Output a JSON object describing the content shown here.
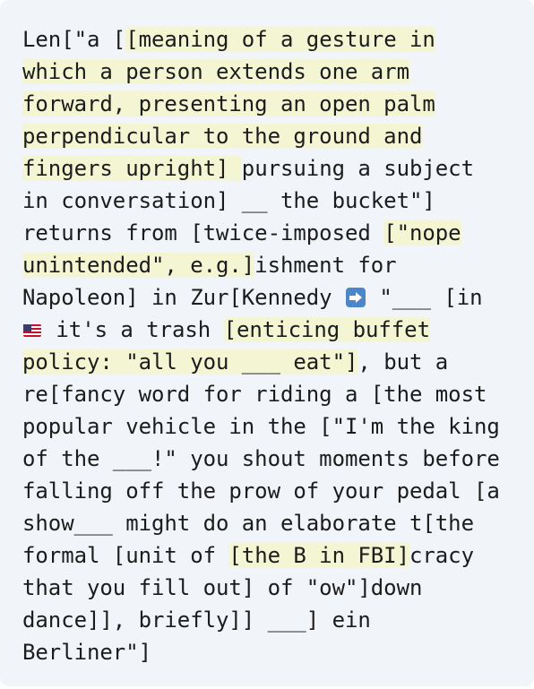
{
  "colors": {
    "background": "#f1f4f9",
    "highlight": "#f4f6d3",
    "text": "#1c1c1c"
  },
  "lines": [
    [
      {
        "t": "Len[\"a ["
      },
      {
        "t": "[meaning of a gesture in",
        "hl": true
      }
    ],
    [
      {
        "t": "which a person extends one arm",
        "hl": true
      }
    ],
    [
      {
        "t": "forward, presenting an open palm",
        "hl": true
      }
    ],
    [
      {
        "t": "perpendicular to the ground and",
        "hl": true
      }
    ],
    [
      {
        "t": "fingers upright] ",
        "hl": true
      },
      {
        "t": "pursuing a subject"
      }
    ],
    [
      {
        "t": "in conversation] __ the bucket\"]"
      }
    ],
    [
      {
        "t": "returns from [twice-imposed "
      },
      {
        "t": "[\"nope",
        "hl": true
      }
    ],
    [
      {
        "t": "unintended\", e.g.]",
        "hl": true
      },
      {
        "t": "ishment for"
      }
    ],
    [
      {
        "t": "Napoleon] in Zur[Kennedy "
      },
      {
        "icon": "right-arrow-emoji-icon"
      },
      {
        "t": " \"___ [in"
      }
    ],
    [
      {
        "icon": "us-flag-emoji-icon"
      },
      {
        "t": " it's a trash "
      },
      {
        "t": "[enticing buffet",
        "hl": true
      }
    ],
    [
      {
        "t": "policy: \"all you ___ eat\"]",
        "hl": true
      },
      {
        "t": ", but a"
      }
    ],
    [
      {
        "t": "re[fancy word for riding a [the most"
      }
    ],
    [
      {
        "t": "popular vehicle in the [\"I'm the king"
      }
    ],
    [
      {
        "t": "of the ___!\" you shout moments before"
      }
    ],
    [
      {
        "t": "falling off the prow of your pedal [a"
      }
    ],
    [
      {
        "t": "show___ might do an elaborate t[the"
      }
    ],
    [
      {
        "t": "formal [unit of "
      },
      {
        "t": "[the B in FBI]",
        "hl": true
      },
      {
        "t": "cracy"
      }
    ],
    [
      {
        "t": "that you fill out] of \"ow\"]down"
      }
    ],
    [
      {
        "t": "dance]], briefly]] ___] ein"
      }
    ],
    [
      {
        "t": "Berliner\"]"
      }
    ]
  ]
}
